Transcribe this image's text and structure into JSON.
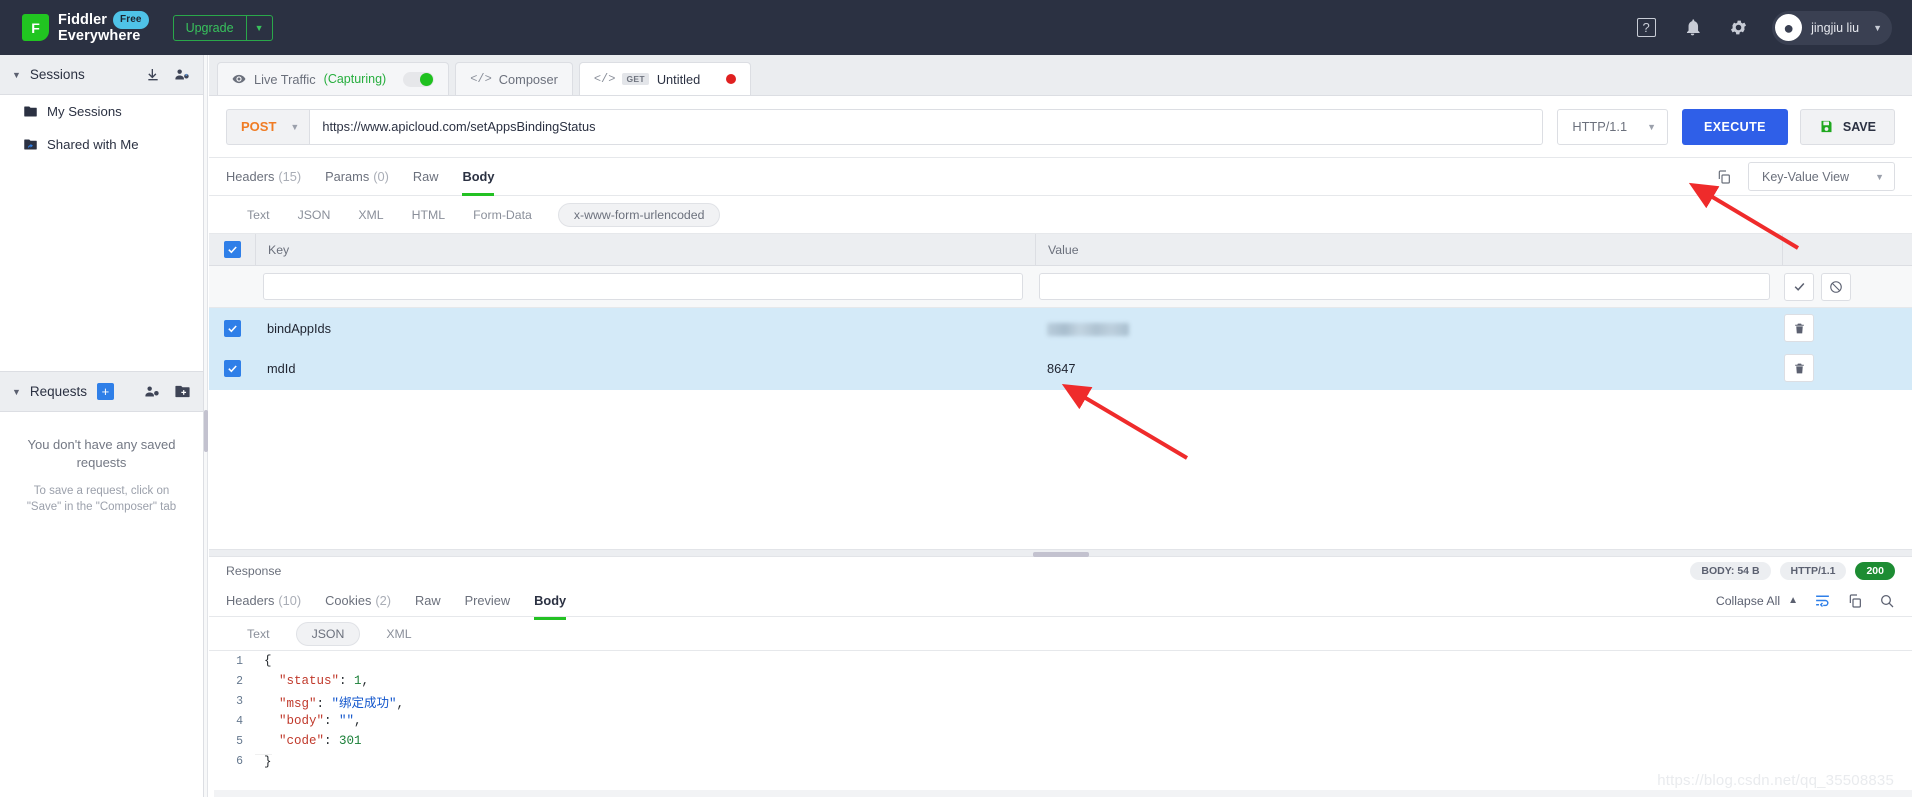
{
  "header": {
    "brand_line1": "Fiddler",
    "brand_line2": "Everywhere",
    "brand_badge": "Free",
    "logo_letter": "F",
    "upgrade_label": "Upgrade",
    "user_name": "jingjiu liu",
    "icons": [
      "help-icon",
      "bell-icon",
      "gear-icon"
    ]
  },
  "sidebar": {
    "sessions": {
      "title": "Sessions",
      "items": [
        {
          "label": "My Sessions",
          "icon": "folder-icon"
        },
        {
          "label": "Shared with Me",
          "icon": "shared-folder-icon"
        }
      ]
    },
    "requests": {
      "title": "Requests",
      "empty_title": "You don't have any saved requests",
      "empty_sub": "To save a request, click on \"Save\" in the \"Composer\" tab"
    }
  },
  "tabs": [
    {
      "label": "Live Traffic",
      "status": "(Capturing)",
      "active": false,
      "toggle": "on"
    },
    {
      "label": "Composer",
      "active": false
    },
    {
      "label": "Untitled",
      "verb": "GET",
      "active": true,
      "dirty": true
    }
  ],
  "request": {
    "method": "POST",
    "url": "https://www.apicloud.com/setAppsBindingStatus",
    "http_version": "HTTP/1.1",
    "execute_label": "EXECUTE",
    "save_label": "SAVE",
    "subtabs": [
      {
        "label": "Headers",
        "count": "(15)",
        "active": false
      },
      {
        "label": "Params",
        "count": "(0)",
        "active": false
      },
      {
        "label": "Raw",
        "count": "",
        "active": false
      },
      {
        "label": "Body",
        "count": "",
        "active": true
      }
    ],
    "view_mode": "Key-Value View",
    "body_formats": [
      {
        "label": "Text",
        "active": false
      },
      {
        "label": "JSON",
        "active": false
      },
      {
        "label": "XML",
        "active": false
      },
      {
        "label": "HTML",
        "active": false
      },
      {
        "label": "Form-Data",
        "active": false
      },
      {
        "label": "x-www-form-urlencoded",
        "active": true
      }
    ],
    "table": {
      "columns": [
        "Key",
        "Value"
      ],
      "new_row": {
        "key_value": "",
        "value_value": ""
      },
      "rows": [
        {
          "checked": true,
          "key": "bindAppIds",
          "value": "",
          "value_redacted": true
        },
        {
          "checked": true,
          "key": "mdId",
          "value": "8647",
          "value_redacted": false
        }
      ]
    }
  },
  "response": {
    "label": "Response",
    "badges": {
      "body_size": "BODY: 54 B",
      "http_version": "HTTP/1.1",
      "status": "200"
    },
    "tabs": [
      {
        "label": "Headers",
        "count": "(10)",
        "active": false
      },
      {
        "label": "Cookies",
        "count": "(2)",
        "active": false
      },
      {
        "label": "Raw",
        "count": "",
        "active": false
      },
      {
        "label": "Preview",
        "count": "",
        "active": false
      },
      {
        "label": "Body",
        "count": "",
        "active": true
      }
    ],
    "collapse_label": "Collapse All",
    "formats": [
      {
        "label": "Text",
        "active": false
      },
      {
        "label": "JSON",
        "active": true
      },
      {
        "label": "XML",
        "active": false
      }
    ],
    "json_lines": [
      {
        "n": "1",
        "segments": [
          {
            "t": "{",
            "c": "brace"
          }
        ]
      },
      {
        "n": "2",
        "segments": [
          {
            "t": "  \"status\"",
            "c": "key"
          },
          {
            "t": ": ",
            "c": "punc"
          },
          {
            "t": "1",
            "c": "num"
          },
          {
            "t": ",",
            "c": "punc"
          }
        ]
      },
      {
        "n": "3",
        "segments": [
          {
            "t": "  \"msg\"",
            "c": "key"
          },
          {
            "t": ": ",
            "c": "punc"
          },
          {
            "t": "\"绑定成功\"",
            "c": "str"
          },
          {
            "t": ",",
            "c": "punc"
          }
        ]
      },
      {
        "n": "4",
        "segments": [
          {
            "t": "  \"body\"",
            "c": "key"
          },
          {
            "t": ": ",
            "c": "punc"
          },
          {
            "t": "\"\"",
            "c": "str"
          },
          {
            "t": ",",
            "c": "punc"
          }
        ]
      },
      {
        "n": "5",
        "segments": [
          {
            "t": "  \"code\"",
            "c": "key"
          },
          {
            "t": ": ",
            "c": "punc"
          },
          {
            "t": "301",
            "c": "num"
          }
        ]
      },
      {
        "n": "6",
        "segments": [
          {
            "t": "}",
            "c": "brace"
          }
        ]
      }
    ]
  },
  "watermark": "https://blog.csdn.net/qq_35508835",
  "colors": {
    "header_bg": "#2b3142",
    "accent_blue": "#2f5fe8",
    "accent_green": "#23c123",
    "method_orange": "#f07c24",
    "row_highlight": "#d4eaf8",
    "status_green": "#1d8c33",
    "annotation_red": "#ef2b2b"
  }
}
